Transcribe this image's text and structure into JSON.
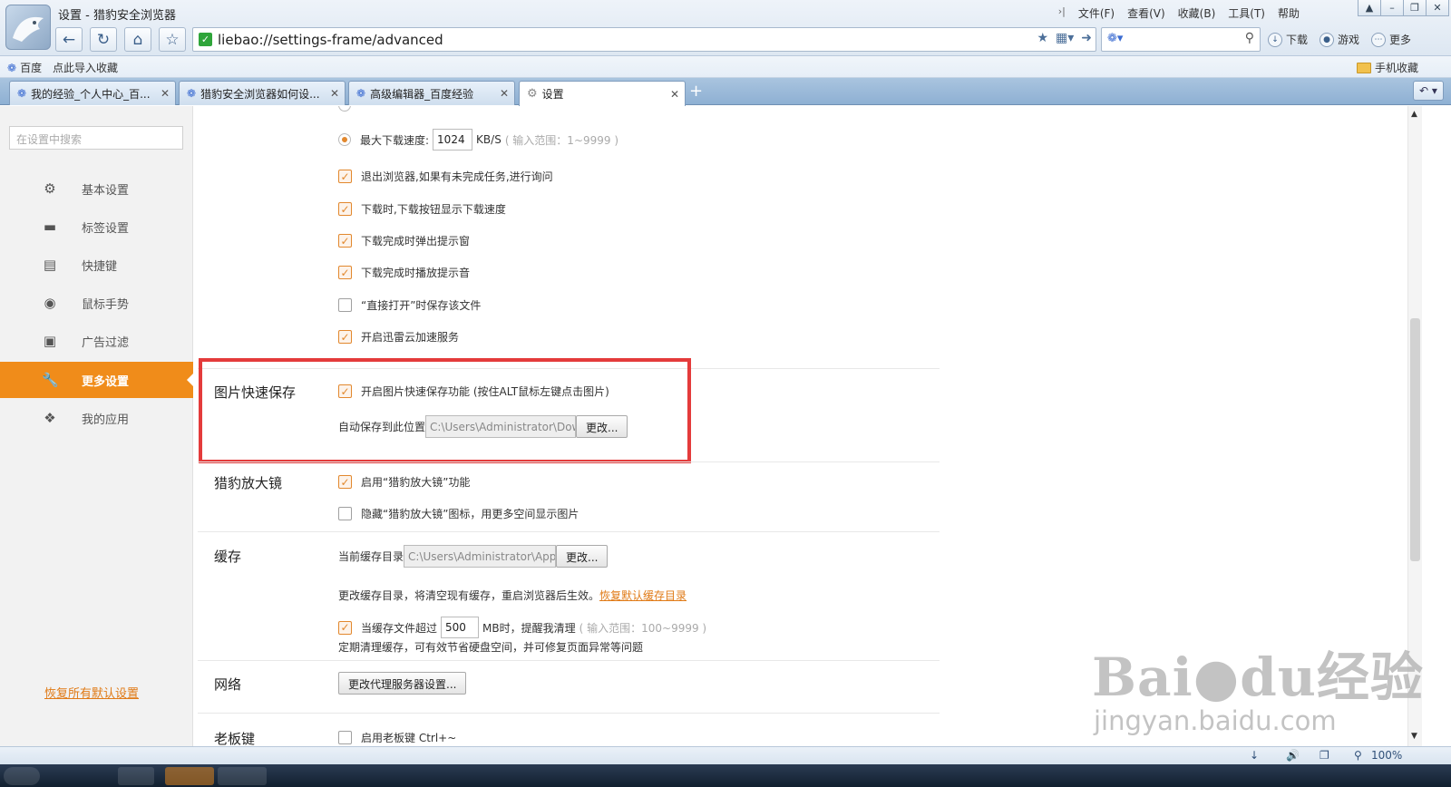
{
  "window": {
    "title": "设置 - 猎豹安全浏览器",
    "menu_arrow": "›|",
    "menu": [
      "文件(F)",
      "查看(V)",
      "收藏(B)",
      "工具(T)",
      "帮助"
    ]
  },
  "toolbar": {
    "address": "liebao://settings-frame/advanced",
    "download_label": "下载",
    "games_label": "游戏",
    "more_label": "更多"
  },
  "bookmarks": {
    "items": [
      "百度",
      "点此导入收藏"
    ],
    "mobile_label": "手机收藏"
  },
  "tabs": [
    {
      "label": "我的经验_个人中心_百...",
      "icon": "paw-icon",
      "active": false
    },
    {
      "label": "猎豹安全浏览器如何设...",
      "icon": "paw-icon",
      "active": false
    },
    {
      "label": "高级编辑器_百度经验",
      "icon": "paw-icon",
      "active": false
    },
    {
      "label": "设置",
      "icon": "gear-icon",
      "active": true
    }
  ],
  "sidebar": {
    "search_placeholder": "在设置中搜索",
    "items": [
      {
        "label": "基本设置",
        "icon": "gear-icon"
      },
      {
        "label": "标签设置",
        "icon": "tab-icon"
      },
      {
        "label": "快捷键",
        "icon": "keyboard-icon"
      },
      {
        "label": "鼠标手势",
        "icon": "mouse-icon"
      },
      {
        "label": "广告过滤",
        "icon": "window-icon"
      },
      {
        "label": "更多设置",
        "icon": "wrench-icon",
        "active": true
      },
      {
        "label": "我的应用",
        "icon": "puzzle-icon"
      }
    ],
    "reset_label": "恢复所有默认设置"
  },
  "download": {
    "max_speed_label": "最大下载速度:",
    "max_speed_value": "1024",
    "max_speed_unit": "KB/S",
    "max_speed_hint": "( 输入范围：1~9999 )",
    "options": [
      {
        "label": "退出浏览器,如果有未完成任务,进行询问",
        "checked": true
      },
      {
        "label": "下载时,下载按钮显示下载速度",
        "checked": true
      },
      {
        "label": "下载完成时弹出提示窗",
        "checked": true
      },
      {
        "label": "下载完成时播放提示音",
        "checked": true
      },
      {
        "label": "“直接打开”时保存该文件",
        "checked": false
      },
      {
        "label": "开启迅雷云加速服务",
        "checked": true
      }
    ]
  },
  "image_save": {
    "section_label": "图片快速保存",
    "enable_label": "开启图片快速保存功能 (按住ALT鼠标左键点击图片)",
    "enabled": true,
    "path_label": "自动保存到此位置",
    "path_value": "C:\\Users\\Administrator\\Dow",
    "change_label": "更改..."
  },
  "magnifier": {
    "section_label": "猎豹放大镜",
    "options": [
      {
        "label": "启用“猎豹放大镜”功能",
        "checked": true
      },
      {
        "label": "隐藏“猎豹放大镜”图标，用更多空间显示图片",
        "checked": false
      }
    ]
  },
  "cache": {
    "section_label": "缓存",
    "dir_label": "当前缓存目录",
    "dir_value": "C:\\Users\\Administrator\\AppD",
    "change_label": "更改...",
    "note": "更改缓存目录，将清空现有缓存，重启浏览器后生效。",
    "restore_link": "恢复默认缓存目录",
    "limit_prefix": "当缓存文件超过",
    "limit_value": "500",
    "limit_suffix": "MB时，提醒我清理",
    "limit_hint": "( 输入范围：100~9999 )",
    "limit_checked": true,
    "limit_note": "定期清理缓存，可有效节省硬盘空间，并可修复页面异常等问题"
  },
  "network": {
    "section_label": "网络",
    "proxy_button": "更改代理服务器设置..."
  },
  "boss_key": {
    "section_label": "老板键",
    "option_label": "启用老板键  Ctrl+~",
    "checked": false
  },
  "status": {
    "zoom": "100%"
  },
  "watermark": {
    "text": "Bai●du经验",
    "sub": "jingyan.baidu.com"
  },
  "colors": {
    "accent": "#f08c1a",
    "highlight_box": "#e43b3b",
    "link": "#e07a16"
  }
}
